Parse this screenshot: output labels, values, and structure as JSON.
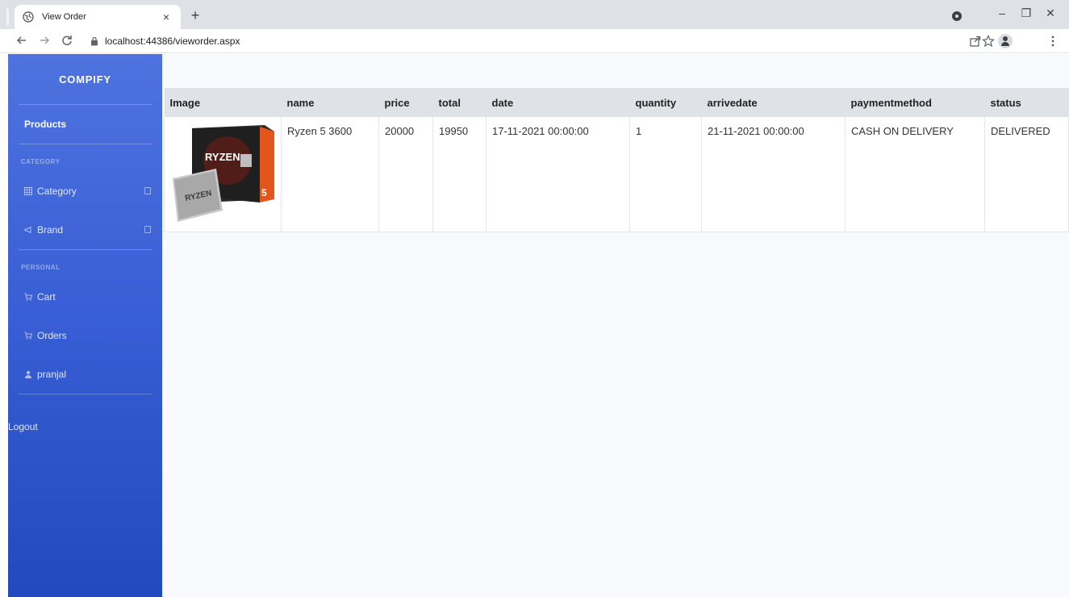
{
  "browser": {
    "tab_title": "View Order",
    "tab_close": "×",
    "new_tab": "+",
    "url": "localhost:44386/vieworder.aspx",
    "window_controls": {
      "minimize": "–",
      "restore": "❐",
      "close": "✕"
    }
  },
  "sidebar": {
    "brand": "COMPIFY",
    "products_label": "Products",
    "category_heading": "CATEGORY",
    "category_label": "Category",
    "brand_label": "Brand",
    "personal_heading": "PERSONAL",
    "cart_label": "Cart",
    "orders_label": "Orders",
    "user_label": "pranjal",
    "logout_label": "Logout"
  },
  "table": {
    "headers": [
      "Image",
      "name",
      "price",
      "total",
      "date",
      "quantity",
      "arrivedate",
      "paymentmethod",
      "status"
    ],
    "rows": [
      {
        "name": "Ryzen 5 3600",
        "price": "20000",
        "total": "19950",
        "date": "17-11-2021 00:00:00",
        "quantity": "1",
        "arrivedate": "21-11-2021 00:00:00",
        "paymentmethod": "CASH ON DELIVERY",
        "status": "DELIVERED",
        "image_box_text": "RYZEN",
        "image_chip_text": "RYZEN",
        "image_badge": "5"
      }
    ]
  },
  "colors": {
    "sidebar_top": "#4e73df",
    "sidebar_bottom": "#224abe",
    "header_bg": "#dfe2e6",
    "content_bg": "#f8f9fc"
  },
  "icons": [
    "globe-icon",
    "lock-icon",
    "back-icon",
    "forward-icon",
    "reload-icon",
    "share-icon",
    "star-icon",
    "profile-icon",
    "menu-icon",
    "table-icon",
    "bullhorn-icon",
    "cart-icon",
    "user-icon"
  ]
}
